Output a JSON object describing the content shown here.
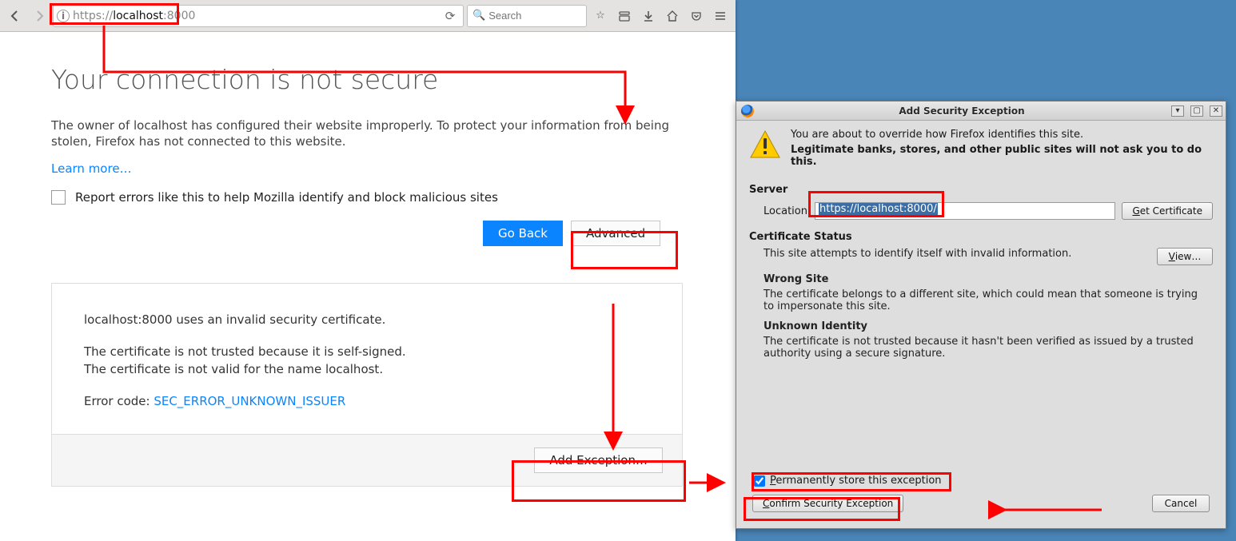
{
  "browser": {
    "url_display_prefix": "https://",
    "url_display_host": "localhost",
    "url_display_suffix": ":8000",
    "search_placeholder": "Search",
    "page": {
      "heading": "Your connection is not secure",
      "paragraph": "The owner of localhost has configured their website improperly. To protect your information from being stolen, Firefox has not connected to this website.",
      "learn_more": "Learn more…",
      "report_label": "Report errors like this to help Mozilla identify and block malicious sites",
      "go_back": "Go Back",
      "advanced": "Advanced"
    },
    "advanced": {
      "line1": "localhost:8000 uses an invalid security certificate.",
      "line2": "The certificate is not trusted because it is self-signed.",
      "line3": "The certificate is not valid for the name localhost.",
      "error_code_label": "Error code: ",
      "error_code": "SEC_ERROR_UNKNOWN_ISSUER",
      "add_exception": "Add Exception…"
    }
  },
  "dialog": {
    "title": "Add Security Exception",
    "intro1": "You are about to override how Firefox identifies this site.",
    "intro2": "Legitimate banks, stores, and other public sites will not ask you to do this.",
    "server_head": "Server",
    "location_label": "Location:",
    "location_value": "https://localhost:8000/",
    "get_cert": "Get Certificate",
    "cert_status_head": "Certificate Status",
    "cert_status_text": "This site attempts to identify itself with invalid information.",
    "view": "View…",
    "wrong_site_head": "Wrong Site",
    "wrong_site_text": "The certificate belongs to a different site, which could mean that someone is trying to impersonate this site.",
    "unknown_head": "Unknown Identity",
    "unknown_text": "The certificate is not trusted because it hasn't been verified as issued by a trusted authority using a secure signature.",
    "perm_label": "Permanently store this exception",
    "confirm": "Confirm Security Exception",
    "cancel": "Cancel"
  }
}
